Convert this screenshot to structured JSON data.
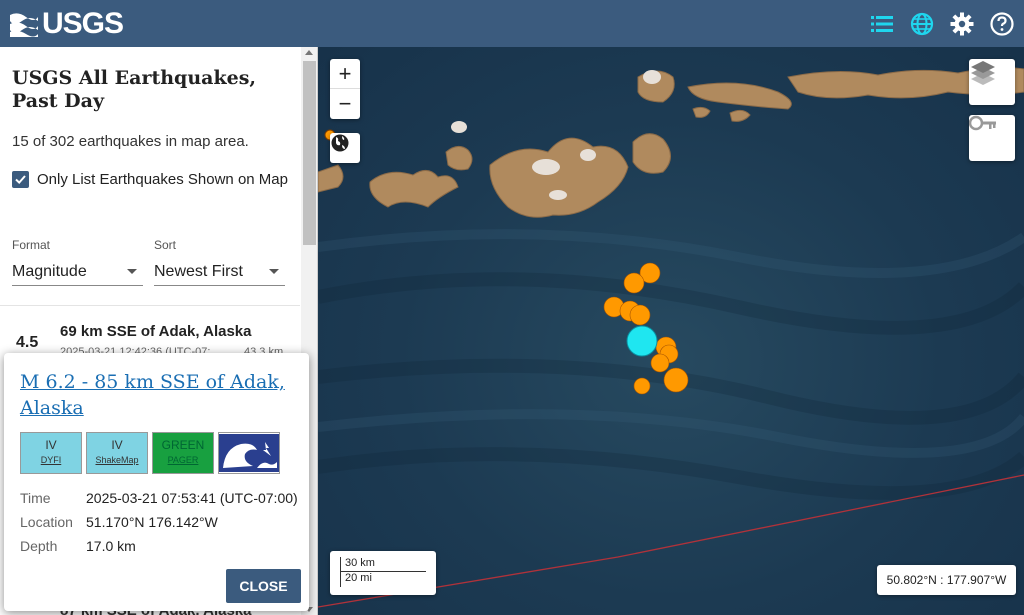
{
  "header": {
    "logo_text": "USGS",
    "icons": [
      "list-icon",
      "globe-icon",
      "gear-icon",
      "help-icon"
    ]
  },
  "sidebar": {
    "title": "USGS All Earthquakes, Past Day",
    "count_text": "15 of 302 earthquakes in map area.",
    "only_list_label": "Only List Earthquakes Shown on Map",
    "only_list_checked": true,
    "format": {
      "label": "Format",
      "value": "Magnitude"
    },
    "sort": {
      "label": "Sort",
      "value": "Newest First"
    },
    "list": [
      {
        "mag": "4.5",
        "place": "69 km SSE of Adak, Alaska",
        "time": "2025-03-21 12:42:36 (UTC-07:",
        "depth": "43.3 km"
      }
    ],
    "next_item_partial": "87 km SSE of Adak, Alaska"
  },
  "map": {
    "zoom_in_label": "+",
    "zoom_out_label": "−",
    "scale_km": "30 km",
    "scale_mi": "20 mi",
    "coordinates": "50.802°N : 177.907°W",
    "quake_color": "#ff9900",
    "selected_color": "#1fe6f0"
  },
  "popup": {
    "title": "M 6.2 - 85 km SSE of Adak, Alaska",
    "badges": [
      {
        "top": "IV",
        "bottom": "DYFI"
      },
      {
        "top": "IV",
        "bottom": "ShakeMap"
      },
      {
        "top": "GREEN",
        "bottom": "PAGER"
      }
    ],
    "details": [
      {
        "label": "Time",
        "value": "2025-03-21 07:53:41 (UTC-07:00)"
      },
      {
        "label": "Location",
        "value": "51.170°N 176.142°W"
      },
      {
        "label": "Depth",
        "value": "17.0 km"
      }
    ],
    "close_label": "CLOSE"
  }
}
